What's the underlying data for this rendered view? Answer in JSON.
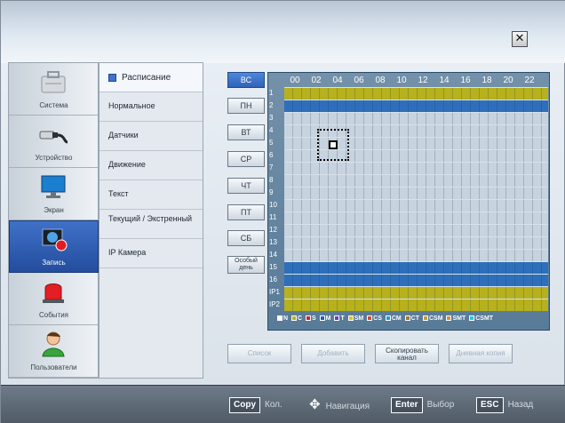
{
  "window": {
    "close_glyph": "✕"
  },
  "left_nav": [
    {
      "label": "Система",
      "icon": "toolbox-icon"
    },
    {
      "label": "Устройство",
      "icon": "connector-icon"
    },
    {
      "label": "Экран",
      "icon": "monitor-icon"
    },
    {
      "label": "Запись",
      "icon": "record-icon",
      "active": true
    },
    {
      "label": "События",
      "icon": "alarm-icon"
    },
    {
      "label": "Пользователи",
      "icon": "user-icon"
    }
  ],
  "submenu": {
    "header": "Расписание",
    "items": [
      "Нормальное",
      "Датчики",
      "Движение",
      "Текст",
      "Текущий / Экстренный",
      "IP Камера"
    ]
  },
  "days": [
    "ВС",
    "ПН",
    "ВТ",
    "СР",
    "ЧТ",
    "ПТ",
    "СБ",
    "Особый день"
  ],
  "grid": {
    "hours": [
      "00",
      "02",
      "04",
      "06",
      "08",
      "10",
      "12",
      "14",
      "16",
      "18",
      "20",
      "22"
    ],
    "rows": [
      "1",
      "2",
      "3",
      "4",
      "5",
      "6",
      "7",
      "8",
      "9",
      "10",
      "11",
      "12",
      "13",
      "14",
      "15",
      "16",
      "IP1",
      "IP2"
    ]
  },
  "legend": [
    {
      "label": "N",
      "color": "#ffffff"
    },
    {
      "label": "C",
      "color": "#b8b31d"
    },
    {
      "label": "S",
      "color": "#d32222"
    },
    {
      "label": "M",
      "color": "#1f5fbf"
    },
    {
      "label": "T",
      "color": "#6b3db4"
    },
    {
      "label": "SM",
      "color": "#e0c51d"
    },
    {
      "label": "CS",
      "color": "#d04a2d"
    },
    {
      "label": "CM",
      "color": "#1e9ed8"
    },
    {
      "label": "CT",
      "color": "#a67a2a"
    },
    {
      "label": "CSM",
      "color": "#c99b31"
    },
    {
      "label": "SMT",
      "color": "#e38b2b"
    },
    {
      "label": "CSMT",
      "color": "#27c6d7"
    }
  ],
  "actions": [
    {
      "label": "Список",
      "enabled": false
    },
    {
      "label": "Добавить",
      "enabled": false
    },
    {
      "label": "Скопировать канал",
      "enabled": true
    },
    {
      "label": "Дневная копия",
      "enabled": false
    }
  ],
  "footer": {
    "copy_key": "Copy",
    "copy_text": "Кол.",
    "nav_text": "Навигация",
    "enter_key": "Enter",
    "enter_text": "Выбор",
    "esc_key": "ESC",
    "esc_text": "Назад"
  }
}
